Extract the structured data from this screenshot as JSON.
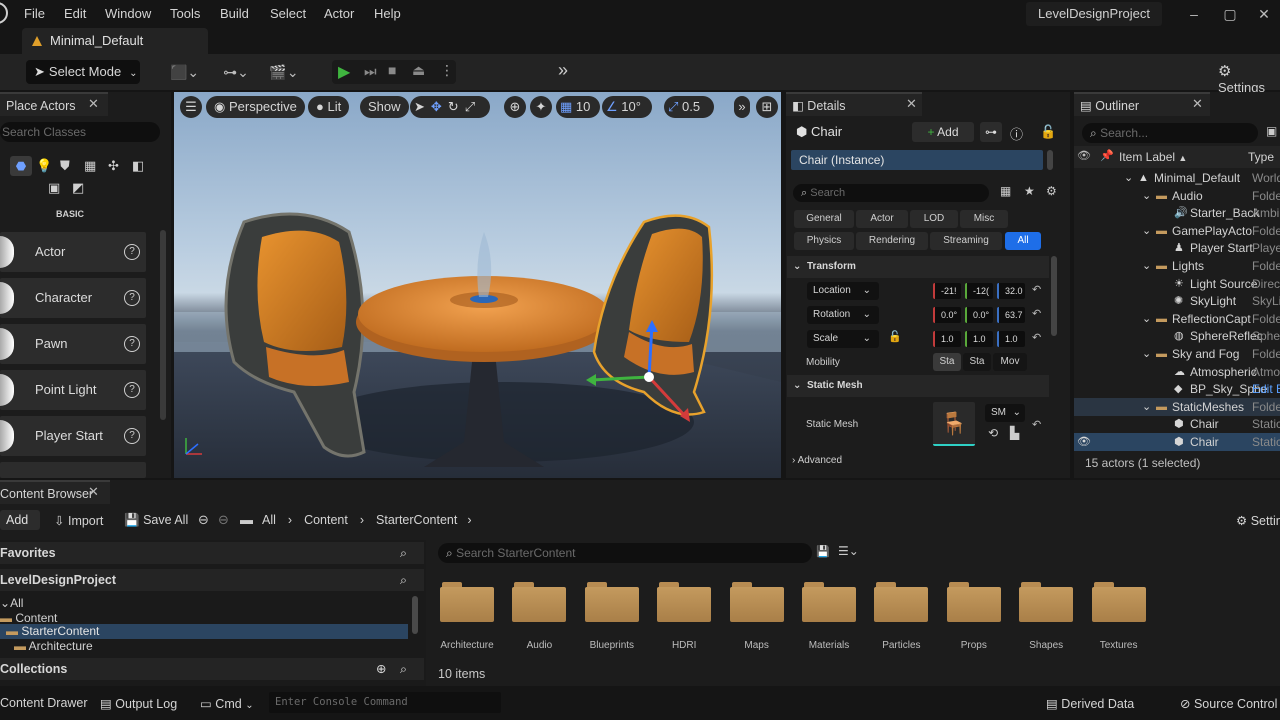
{
  "menu": [
    "File",
    "Edit",
    "Window",
    "Tools",
    "Build",
    "Select",
    "Actor",
    "Help"
  ],
  "project_name": "LevelDesignProject",
  "level_tab": "Minimal_Default",
  "toolbar": {
    "select_mode": "Select Mode",
    "settings": "Settings"
  },
  "place_actors": {
    "title": "Place Actors",
    "search_placeholder": "Search Classes",
    "category": "BASIC",
    "items": [
      "Actor",
      "Character",
      "Pawn",
      "Point Light",
      "Player Start"
    ]
  },
  "viewport": {
    "perspective": "Perspective",
    "lit": "Lit",
    "show": "Show",
    "grid_snap": "10",
    "angle_snap": "10°",
    "scale_snap": "0.5"
  },
  "details": {
    "title": "Details",
    "actor_name": "Chair",
    "add_label": "Add",
    "instance": "Chair (Instance)",
    "search_placeholder": "Search",
    "categories_row1": [
      "General",
      "Actor",
      "LOD",
      "Misc"
    ],
    "categories_row2": [
      "Physics",
      "Rendering",
      "Streaming",
      "All"
    ],
    "transform_header": "Transform",
    "location_label": "Location",
    "rotation_label": "Rotation",
    "scale_label": "Scale",
    "location": [
      "-21!",
      "-12(",
      "32.0"
    ],
    "rotation": [
      "0.0°",
      "0.0°",
      "63.7"
    ],
    "scale": [
      "1.0",
      "1.0",
      "1.0"
    ],
    "mobility_label": "Mobility",
    "mobility_options": [
      "Sta",
      "Sta",
      "Mov"
    ],
    "static_mesh_header": "Static Mesh",
    "static_mesh_label": "Static Mesh",
    "static_mesh_value": "SM",
    "advanced": "Advanced"
  },
  "outliner": {
    "title": "Outliner",
    "search_placeholder": "Search...",
    "col_label": "Item Label",
    "col_type": "Type",
    "rows": [
      {
        "name": "Minimal_Default",
        "type": "World",
        "indent": 0,
        "icon": "level"
      },
      {
        "name": "Audio",
        "type": "Folder",
        "indent": 1,
        "icon": "folder"
      },
      {
        "name": "Starter_Back",
        "type": "Ambi",
        "indent": 2,
        "icon": "speaker"
      },
      {
        "name": "GamePlayActo",
        "type": "Folde",
        "indent": 1,
        "icon": "folder"
      },
      {
        "name": "Player Start",
        "type": "Playe",
        "indent": 2,
        "icon": "person"
      },
      {
        "name": "Lights",
        "type": "Folde",
        "indent": 1,
        "icon": "folder"
      },
      {
        "name": "Light Source",
        "type": "Direc",
        "indent": 2,
        "icon": "sun"
      },
      {
        "name": "SkyLight",
        "type": "SkyLi",
        "indent": 2,
        "icon": "sky"
      },
      {
        "name": "ReflectionCapt",
        "type": "Folde",
        "indent": 1,
        "icon": "folder"
      },
      {
        "name": "SphereReflec",
        "type": "Sphe",
        "indent": 2,
        "icon": "sphere"
      },
      {
        "name": "Sky and Fog",
        "type": "Folde",
        "indent": 1,
        "icon": "folder"
      },
      {
        "name": "Atmospheric",
        "type": "Atmo",
        "indent": 2,
        "icon": "fog"
      },
      {
        "name": "BP_Sky_Sphe",
        "type": "Edit B",
        "indent": 2,
        "icon": "bp"
      },
      {
        "name": "StaticMeshes",
        "type": "Folde",
        "indent": 1,
        "icon": "folder"
      },
      {
        "name": "Chair",
        "type": "Static",
        "indent": 2,
        "icon": "mesh"
      },
      {
        "name": "Chair",
        "type": "Static",
        "indent": 2,
        "icon": "mesh"
      }
    ],
    "footer": "15 actors (1 selected)"
  },
  "content_browser": {
    "title": "Content Browser",
    "add": "Add",
    "import": "Import",
    "save_all": "Save All",
    "breadcrumb": [
      "All",
      "Content",
      "StarterContent"
    ],
    "settings": "Settings",
    "favorites": "Favorites",
    "project": "LevelDesignProject",
    "tree": [
      "All",
      "Content",
      "StarterContent",
      "Architecture"
    ],
    "collections": "Collections",
    "search_placeholder": "Search StarterContent",
    "folders": [
      "Architecture",
      "Audio",
      "Blueprints",
      "HDRI",
      "Maps",
      "Materials",
      "Particles",
      "Props",
      "Shapes",
      "Textures"
    ],
    "item_count": "10 items"
  },
  "statusbar": {
    "content_drawer": "Content Drawer",
    "output_log": "Output Log",
    "cmd": "Cmd",
    "console_placeholder": "Enter Console Command",
    "derived_data": "Derived Data",
    "source_control": "Source Control"
  }
}
